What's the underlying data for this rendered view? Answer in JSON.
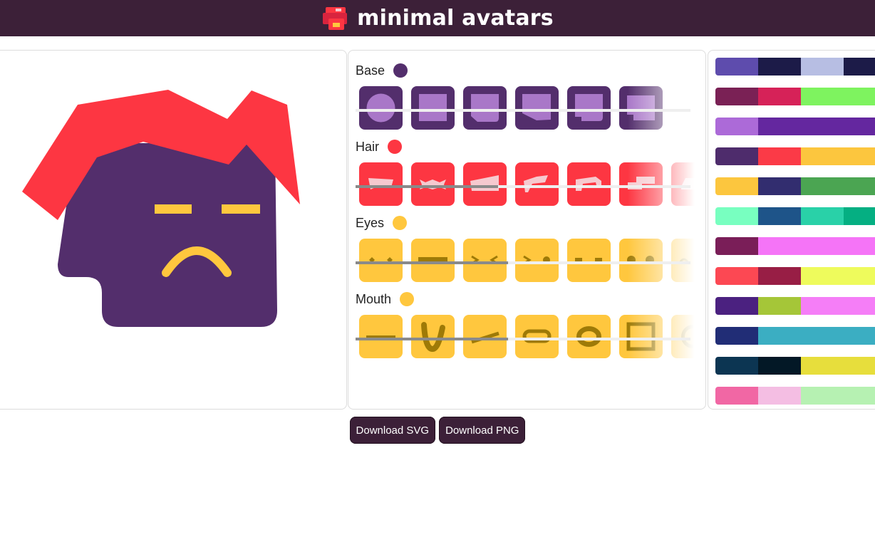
{
  "app": {
    "title": "minimal avatars",
    "logo_icon": "stacked-cube-logo"
  },
  "colors": {
    "header_bg": "#3c2038",
    "base": "#532e6c",
    "base_light": "#a977c8",
    "hair": "#fd3642",
    "hair_light": "#f6c9cf",
    "feature": "#ffc73e",
    "feature_dark": "#9e7a07"
  },
  "sections": [
    {
      "label": "Base",
      "color": "#532e6c",
      "tiles": 6
    },
    {
      "label": "Hair",
      "color": "#fd3642",
      "tiles": 7
    },
    {
      "label": "Eyes",
      "color": "#ffc73e",
      "tiles": 7
    },
    {
      "label": "Mouth",
      "color": "#ffc73e",
      "tiles": 7
    }
  ],
  "palettes": [
    [
      "#5e4cad",
      "#1c1b48",
      "#b7bee3",
      "#1c1b48"
    ],
    [
      "#7a2155",
      "#d62258",
      "#7ef35f",
      "#7ef35f"
    ],
    [
      "#ac6ad8",
      "#64279f",
      "#64279f",
      "#64279f"
    ],
    [
      "#4e2c6c",
      "#fb3a47",
      "#fcc63e",
      "#fcc63e"
    ],
    [
      "#fcc63e",
      "#322d6f",
      "#4ba552",
      "#4ba552"
    ],
    [
      "#78ffc0",
      "#1e5489",
      "#29d1a8",
      "#05af82"
    ],
    [
      "#7a1e58",
      "#f574f7",
      "#f574f7",
      "#f574f7"
    ],
    [
      "#fc4853",
      "#981e45",
      "#eefb5c",
      "#eefb5c"
    ],
    [
      "#4b2180",
      "#a5c638",
      "#f57ef7",
      "#f57ef7"
    ],
    [
      "#212d76",
      "#3baec2",
      "#3baec2",
      "#3baec2"
    ],
    [
      "#0c3552",
      "#031826",
      "#e7de3c",
      "#e7de3c"
    ],
    [
      "#f167a4",
      "#f4bee3",
      "#b6f1b2",
      "#b6f1b2"
    ]
  ],
  "buttons": {
    "download_svg": "Download SVG",
    "download_png": "Download PNG"
  }
}
